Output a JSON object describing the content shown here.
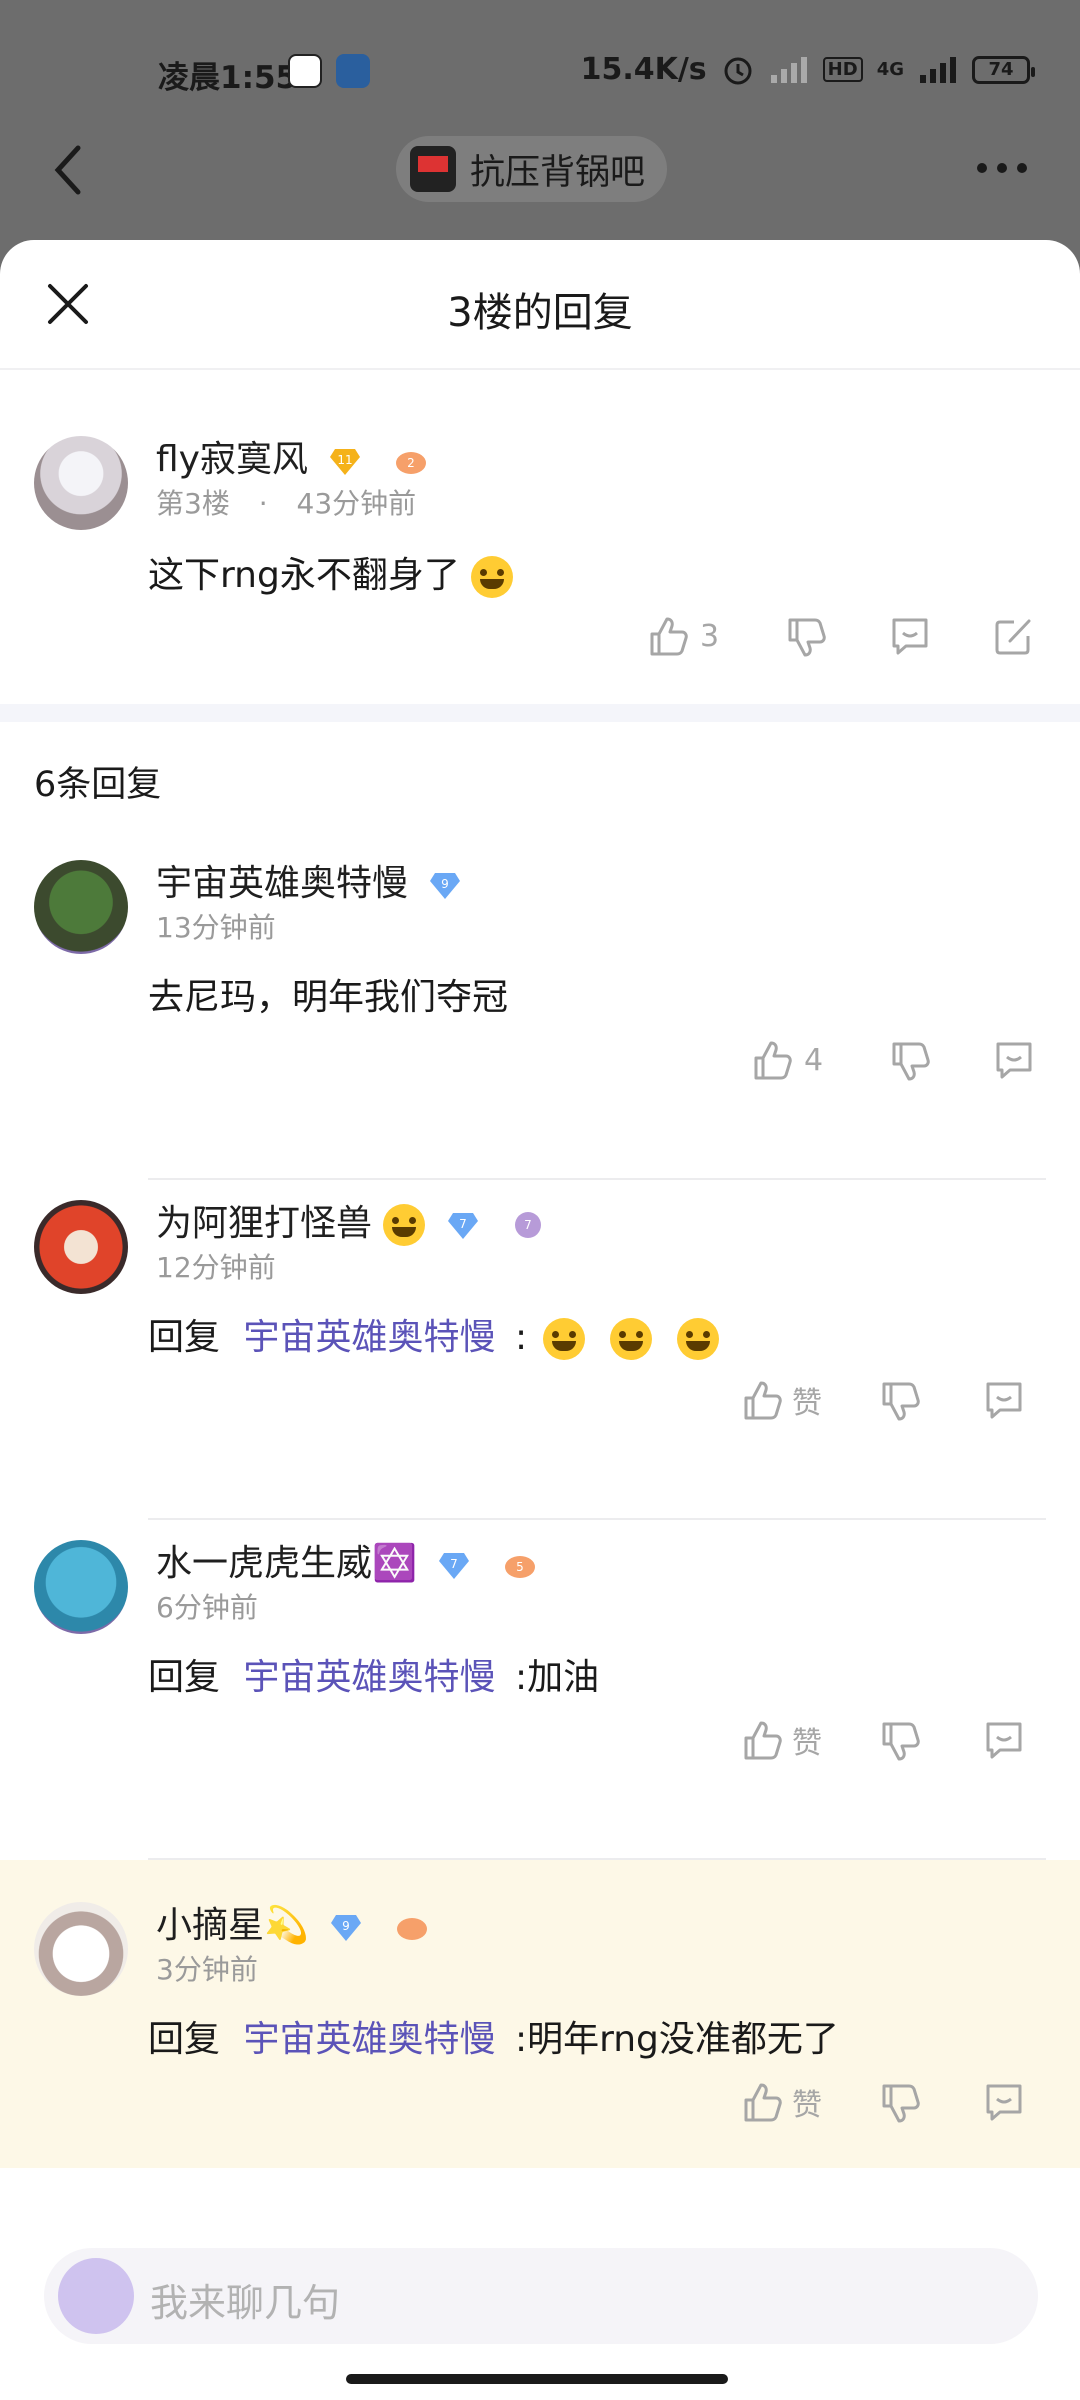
{
  "status_bar": {
    "time": "凌晨1:55",
    "net_speed": "15.4K/s",
    "network": "4G",
    "battery": "74"
  },
  "top_nav": {
    "forum_name": "抗压背锅吧"
  },
  "sheet": {
    "title": "3楼的回复"
  },
  "main_post": {
    "user": "fly寂寞风",
    "level": "11",
    "badge": "2",
    "floor": "第3楼",
    "time": "43分钟前",
    "content": "这下rng永不翻身了",
    "likes": "3"
  },
  "replies_count": "6条回复",
  "replies": [
    {
      "user": "宇宙英雄奥特慢",
      "level": "9",
      "time": "13分钟前",
      "content": "去尼玛，明年我们夺冠",
      "likes": "4"
    },
    {
      "user": "为阿狸打怪兽",
      "level": "7",
      "badge": "7",
      "time": "12分钟前",
      "reply_prefix": "回复",
      "reply_to": "宇宙英雄奥特慢",
      "content": " :",
      "likes": "赞"
    },
    {
      "user": "水一虎虎生威✡️",
      "level": "7",
      "badge": "5",
      "time": "6分钟前",
      "reply_prefix": "回复",
      "reply_to": "宇宙英雄奥特慢",
      "content": " :加油",
      "likes": "赞"
    },
    {
      "user": "小摘星💫",
      "level": "9",
      "badge": "",
      "time": "3分钟前",
      "reply_prefix": "回复",
      "reply_to": "宇宙英雄奥特慢",
      "content": " :明年rng没准都无了",
      "likes": "赞"
    }
  ],
  "input": {
    "placeholder": "我来聊几句"
  },
  "colors": {
    "accent_link": "#5b53b8",
    "highlight_bg": "#fdf8e7"
  }
}
